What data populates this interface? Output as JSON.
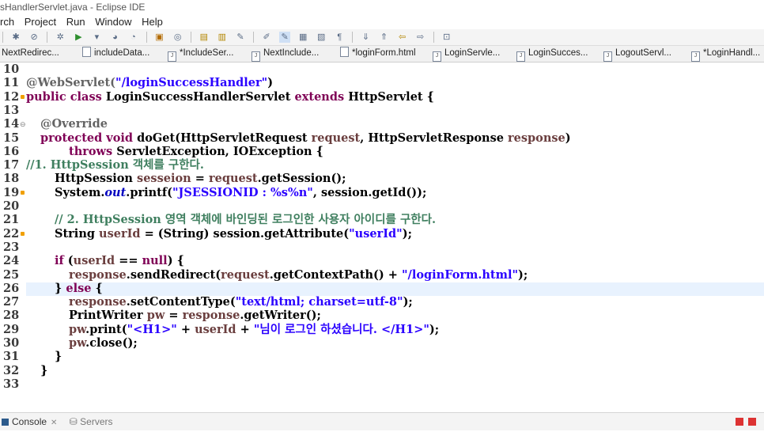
{
  "window": {
    "title": "sHandlerServlet.java - Eclipse IDE"
  },
  "menu": [
    "rch",
    "Project",
    "Run",
    "Window",
    "Help"
  ],
  "toolbar_icons": [
    "debug-icon",
    "skip-icon",
    "settings-icon",
    "run-icon",
    "dropdown-icon",
    "coverage-icon",
    "external-tools-icon",
    "new-class-icon",
    "web-icon",
    "open-type-icon",
    "open-task-icon",
    "search-icon",
    "mark-occurrences-icon",
    "highlight-icon",
    "toggle-block-icon",
    "show-whitespace-icon",
    "pilcrow-icon",
    "next-annotation-icon",
    "prev-annotation-icon",
    "back-icon",
    "forward-icon",
    "pin-icon"
  ],
  "tabs": [
    {
      "label": "NextRedirec..."
    },
    {
      "label": "includeData..."
    },
    {
      "label": "*IncludeSer..."
    },
    {
      "label": "NextInclude..."
    },
    {
      "label": "*loginForm.html"
    },
    {
      "label": "LoginServle..."
    },
    {
      "label": "LoginSucces..."
    },
    {
      "label": "LogoutServl..."
    },
    {
      "label": "*LoginHandl..."
    }
  ],
  "editor": {
    "line_numbers": [
      "10",
      "11",
      "12",
      "13",
      "14",
      "15",
      "16",
      "17",
      "18",
      "19",
      "20",
      "21",
      "22",
      "23",
      "24",
      "25",
      "26",
      "27",
      "28",
      "29",
      "30",
      "31",
      "32",
      "33"
    ],
    "code": {
      "l11_annot": "@WebServlet(",
      "l11_str": "\"/loginSuccessHandler\"",
      "l11_end": ")",
      "l12_kw": "public class ",
      "l12_name": "LoginSuccessHandlerServlet ",
      "l12_kw2": "extends ",
      "l12_end": "HttpServlet {",
      "l14": "@Override",
      "l15_kw": "protected void ",
      "l15_a": "doGet(HttpServletRequest ",
      "l15_v1": "request",
      "l15_b": ", HttpServletResponse ",
      "l15_v2": "response",
      "l15_c": ")",
      "l16_kw": "throws ",
      "l16_rest": "ServletException, IOException {",
      "l17": "//1. HttpSession 객체를 구한다.",
      "l18_a": "HttpSession ",
      "l18_v": "sesseion",
      "l18_b": " = ",
      "l18_v2": "request",
      "l18_c": ".getSession();",
      "l19_a": "System.",
      "l19_out": "out",
      "l19_b": ".printf(",
      "l19_str": "\"JSESSIONID : %s%n\"",
      "l19_c": ", session.getId());",
      "l21": "// 2. HttpSession 영역 객체에 바인딩된 로그인한 사용자 아이디를 구한다.",
      "l22_a": "String ",
      "l22_v": "userId",
      "l22_b": " = (String) session.getAttribute(",
      "l22_str": "\"userId\"",
      "l22_c": ");",
      "l24_kw": "if ",
      "l24_a": "(",
      "l24_v": "userId",
      "l24_b": " == ",
      "l24_kw2": "null",
      "l24_c": ") {",
      "l25_v": "response",
      "l25_a": ".sendRedirect(",
      "l25_v2": "request",
      "l25_b": ".getContextPath() + ",
      "l25_str": "\"/loginForm.html\"",
      "l25_c": ");",
      "l26_a": "} ",
      "l26_kw": "else ",
      "l26_b": "{",
      "l27_v": "response",
      "l27_a": ".setContentType(",
      "l27_str": "\"text/html; charset=utf-8\"",
      "l27_b": ");",
      "l28_a": "PrintWriter ",
      "l28_v": "pw",
      "l28_b": " = ",
      "l28_v2": "response",
      "l28_c": ".getWriter();",
      "l29_v": "pw",
      "l29_a": ".print(",
      "l29_str": "\"<H1>\"",
      "l29_b": " + ",
      "l29_v2": "userId",
      "l29_c": " + ",
      "l29_str2": "\"님이 로그인 하셨습니다. </H1>\"",
      "l29_d": ");",
      "l30_v": "pw",
      "l30_a": ".close();",
      "l31": "}",
      "l32": "}"
    }
  },
  "bottom_panel": {
    "console_tab": "Console",
    "servers_tab": "Servers"
  }
}
